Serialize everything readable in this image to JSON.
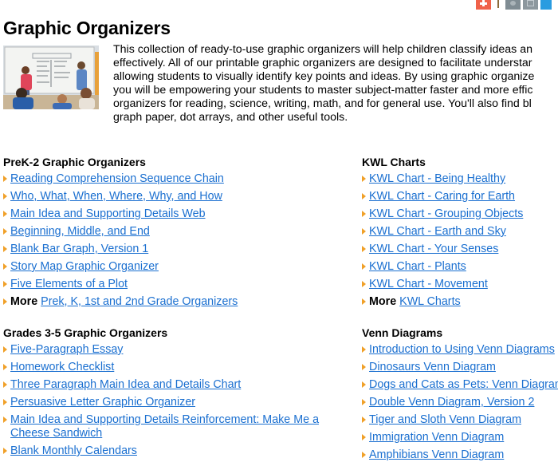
{
  "share_bar": {
    "icons": [
      "add-share-icon",
      "separator",
      "print-icon",
      "email-icon",
      "twitter-icon"
    ]
  },
  "page": {
    "title": "Graphic Organizers",
    "image_alt": "Classroom students at whiteboard",
    "intro_lines": [
      "This collection of ready-to-use graphic organizers will help children classify ideas an",
      "effectively. All of our printable graphic organizers are designed to facilitate understar",
      "allowing students to visually identify key points and ideas. By using graphic organize",
      "you will be empowering your students to master subject-matter faster and more effic",
      "organizers for reading, science, writing, math, and for general use. You'll also find bl",
      "graph paper, dot arrays, and other useful tools."
    ]
  },
  "sections": {
    "prek2": {
      "title": "PreK-2 Graphic Organizers",
      "links": [
        "Reading Comprehension Sequence Chain",
        "Who, What, When, Where, Why, and How",
        "Main Idea and Supporting Details Web",
        "Beginning, Middle, and End",
        "Blank Bar Graph, Version 1",
        "Story Map Graphic Organizer",
        "Five Elements of a Plot"
      ],
      "more_label": "More",
      "more_link": "Prek, K, 1st and 2nd Grade Organizers"
    },
    "kwl": {
      "title": "KWL Charts",
      "links": [
        "KWL Chart - Being Healthy",
        "KWL Chart - Caring for Earth",
        "KWL Chart - Grouping Objects",
        "KWL Chart - Earth and Sky",
        "KWL Chart - Your Senses",
        "KWL Chart - Plants",
        "KWL Chart - Movement"
      ],
      "more_label": "More",
      "more_link": "KWL Charts"
    },
    "grades35": {
      "title": "Grades 3-5 Graphic Organizers",
      "links": [
        "Five-Paragraph Essay",
        "Homework Checklist",
        "Three Paragraph Main Idea and Details Chart",
        "Persuasive Letter Graphic Organizer",
        "Main Idea and Supporting Details Reinforcement: Make Me a Cheese Sandwich",
        "Blank Monthly Calendars"
      ]
    },
    "venn": {
      "title": "Venn Diagrams",
      "links": [
        "Introduction to Using Venn Diagrams",
        "Dinosaurs Venn Diagram",
        "Dogs and Cats as Pets: Venn Diagram",
        "Double Venn Diagram, Version 2",
        "Tiger and Sloth Venn Diagram",
        "Immigration Venn Diagram",
        "Amphibians Venn Diagram"
      ]
    }
  },
  "colors": {
    "link": "#1a6fd0",
    "bullet_arrow": "#f0a028",
    "share_add": "#f0624a",
    "share_twitter": "#2a9ce0"
  }
}
